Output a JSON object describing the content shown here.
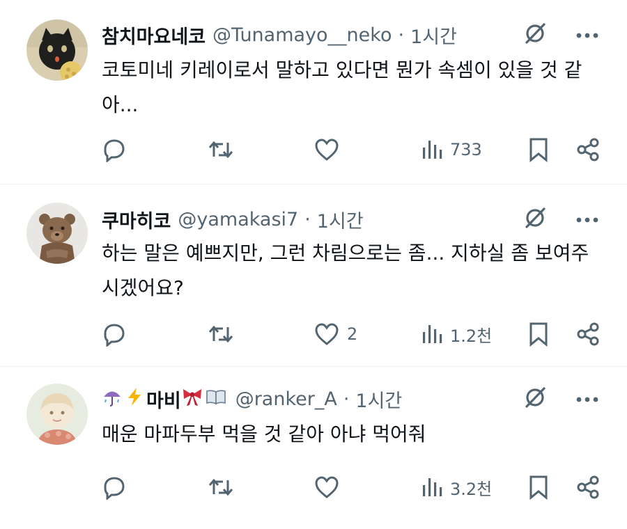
{
  "tweets": [
    {
      "name": "참치마요네코",
      "handle": "@Tunamayo__neko",
      "time": "1시간",
      "text": "코토미네 키레이로서 말하고 있다면 뭔가 속셈이 있을 것 같아...",
      "likes": "",
      "views": "733"
    },
    {
      "name": "쿠마히코",
      "handle": "@yamakasi7",
      "time": "1시간",
      "text": "하는 말은 예쁘지만, 그런 차림으로는 좀... 지하실 좀 보여주시겠어요?",
      "likes": "2",
      "views": "1.2천"
    },
    {
      "name": "마비",
      "handle": "@ranker_A",
      "time": "1시간",
      "text": "매운 마파두부 먹을 것 같아 아냐 먹어줘",
      "likes": "",
      "views": "3.2천"
    }
  ],
  "separator": "·",
  "colors": {
    "text": "#0f1419",
    "secondary": "#536471",
    "divider": "#eff3f4"
  }
}
